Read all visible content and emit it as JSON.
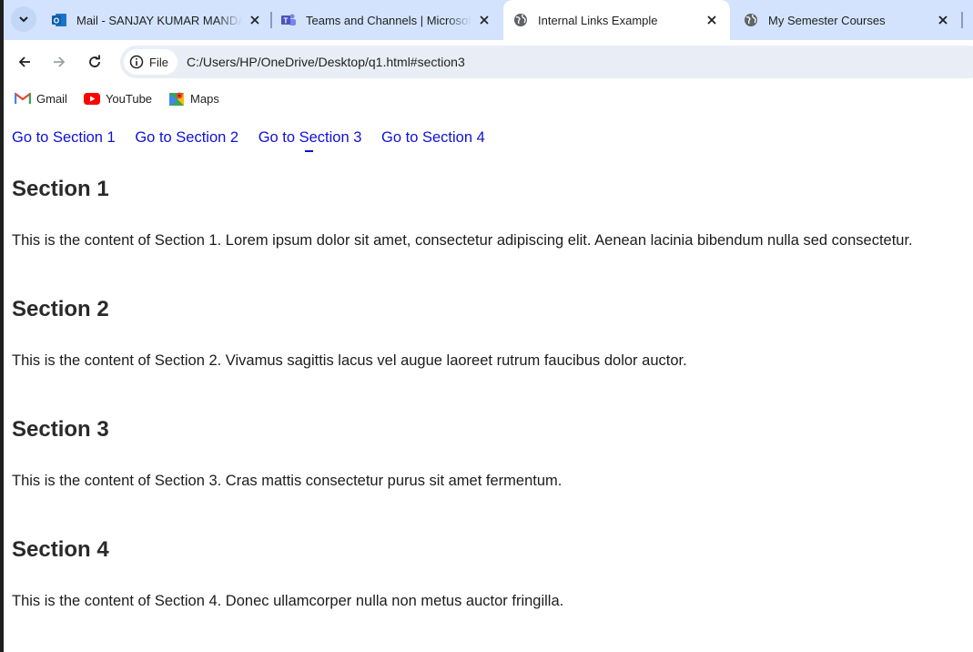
{
  "browser": {
    "tabs": [
      {
        "title": "Mail - SANJAY KUMAR MANDAL - Outlook",
        "favicon": "outlook-icon",
        "active": false
      },
      {
        "title": "Teams and Channels | Microsoft Teams",
        "favicon": "teams-icon",
        "active": false
      },
      {
        "title": "Internal Links Example",
        "favicon": "globe-icon",
        "active": true
      },
      {
        "title": "My Semester Courses",
        "favicon": "globe-icon",
        "active": false
      }
    ],
    "address": {
      "chip_label": "File",
      "url": "C:/Users/HP/OneDrive/Desktop/q1.html#section3"
    },
    "bookmarks": [
      {
        "label": "Gmail",
        "icon": "gmail-icon"
      },
      {
        "label": "YouTube",
        "icon": "youtube-icon"
      },
      {
        "label": "Maps",
        "icon": "maps-icon"
      }
    ]
  },
  "page": {
    "nav_links": [
      "Go to Section 1",
      "Go to Section 2",
      "Go to Section 3",
      "Go to Section 4"
    ],
    "sections": [
      {
        "heading": "Section 1",
        "text": "This is the content of Section 1. Lorem ipsum dolor sit amet, consectetur adipiscing elit. Aenean lacinia bibendum nulla sed consectetur."
      },
      {
        "heading": "Section 2",
        "text": "This is the content of Section 2. Vivamus sagittis lacus vel augue laoreet rutrum faucibus dolor auctor."
      },
      {
        "heading": "Section 3",
        "text": "This is the content of Section 3. Cras mattis consectetur purus sit amet fermentum."
      },
      {
        "heading": "Section 4",
        "text": "This is the content of Section 4. Donec ullamcorper nulla non metus auctor fringilla."
      }
    ]
  },
  "colors": {
    "tabstrip_bg": "#d3e3fd",
    "omnibox_bg": "#e9eef6",
    "link": "#1010d8",
    "text": "#1c1c1c"
  }
}
